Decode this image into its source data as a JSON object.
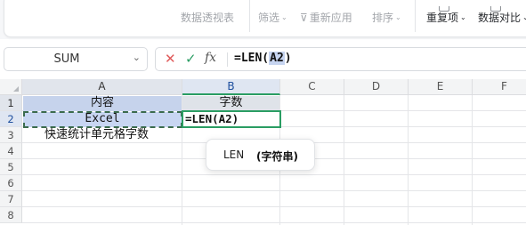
{
  "ribbon": {
    "items": [
      {
        "label": "数据透视表",
        "enabled": false,
        "caret": false
      },
      {
        "label": "筛选",
        "enabled": false,
        "caret": true
      },
      {
        "label": "重新应用",
        "enabled": false,
        "caret": false
      },
      {
        "label": "排序",
        "enabled": false,
        "caret": true
      },
      {
        "label": "重复项",
        "enabled": true,
        "caret": true
      },
      {
        "label": "数据对比",
        "enabled": true,
        "caret": true
      }
    ]
  },
  "namebox": {
    "value": "SUM"
  },
  "formula_bar": {
    "cancel_symbol": "✕",
    "confirm_symbol": "✓",
    "fx_symbol": "fx",
    "formula_prefix": "=LEN(",
    "formula_arg": "A2",
    "formula_suffix": ")"
  },
  "columns": [
    "A",
    "B",
    "C",
    "D",
    "E",
    "F"
  ],
  "rows": [
    "1",
    "2",
    "3",
    "4",
    "5",
    "6",
    "7",
    "8"
  ],
  "cells": {
    "A1": "内容",
    "B1": "字数",
    "A2": "Excel",
    "B2": "=LEN(A2)",
    "A3": "快速统计单元格字数"
  },
  "tooltip": {
    "function": "LEN",
    "argument": "(字符串)"
  },
  "colors": {
    "accent_green": "#2a9d63",
    "selection_blue": "#c6d3ec",
    "cancel_red": "#e05a5a"
  }
}
